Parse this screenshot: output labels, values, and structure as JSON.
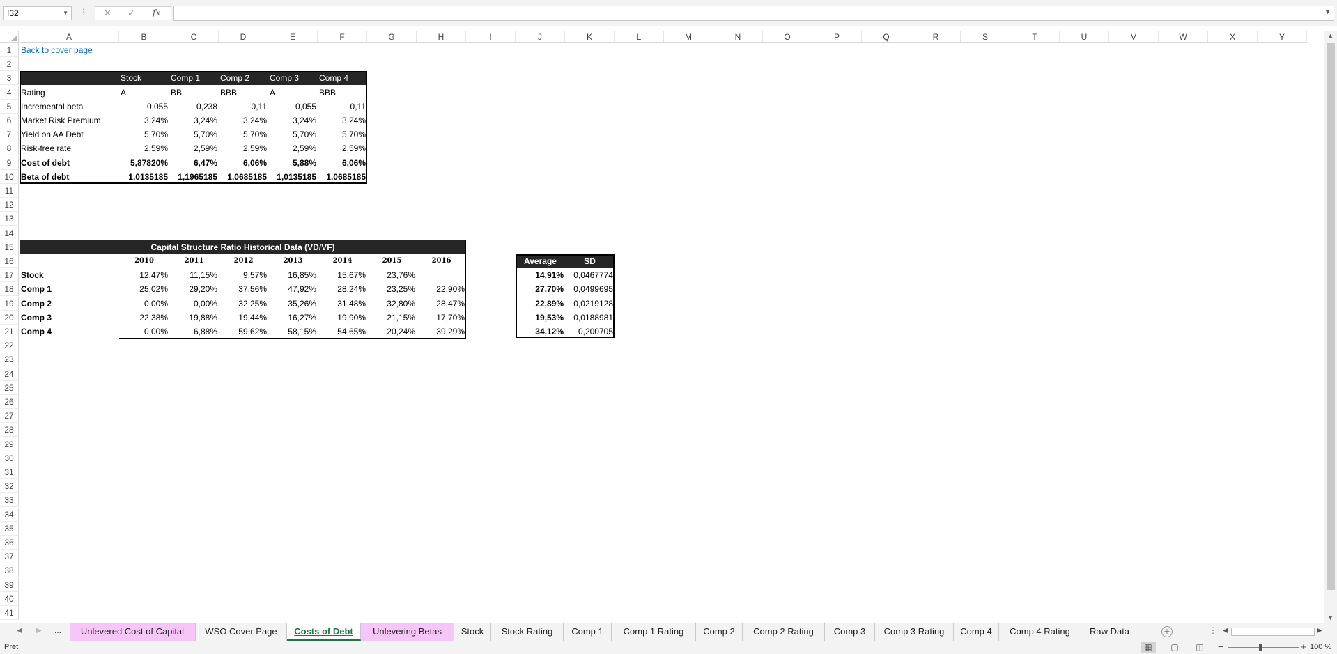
{
  "formula_bar": {
    "name_box": "I32",
    "formula": "",
    "cancel_icon": "✕",
    "enter_icon": "✓",
    "fx_label": "fx"
  },
  "columns": [
    "A",
    "B",
    "C",
    "D",
    "E",
    "F",
    "G",
    "H",
    "I",
    "J",
    "K",
    "L",
    "M",
    "N",
    "O",
    "P",
    "Q",
    "R",
    "S",
    "T",
    "U",
    "V",
    "W",
    "X",
    "Y"
  ],
  "rows": [
    "1",
    "2",
    "3",
    "4",
    "5",
    "6",
    "7",
    "8",
    "9",
    "10",
    "11",
    "12",
    "13",
    "14",
    "15",
    "16",
    "17",
    "18",
    "19",
    "20",
    "21",
    "22",
    "23",
    "24",
    "25",
    "26",
    "27",
    "28",
    "29",
    "30",
    "31",
    "32",
    "33",
    "34",
    "35",
    "36",
    "37",
    "38",
    "39",
    "40",
    "41"
  ],
  "link": {
    "text": "Back to cover page"
  },
  "debt_table": {
    "headers": [
      "Stock",
      "Comp 1",
      "Comp 2",
      "Comp 3",
      "Comp 4"
    ],
    "rows": [
      {
        "label": "Rating",
        "values": [
          "A",
          "BB",
          "BBB",
          "A",
          "BBB"
        ],
        "bold": false,
        "align": "left"
      },
      {
        "label": "Incremental beta",
        "values": [
          "0,055",
          "0,238",
          "0,11",
          "0,055",
          "0,11"
        ],
        "bold": false,
        "align": "right"
      },
      {
        "label": "Market Risk Premium",
        "values": [
          "3,24%",
          "3,24%",
          "3,24%",
          "3,24%",
          "3,24%"
        ],
        "bold": false,
        "align": "right"
      },
      {
        "label": "Yield on AA Debt",
        "values": [
          "5,70%",
          "5,70%",
          "5,70%",
          "5,70%",
          "5,70%"
        ],
        "bold": false,
        "align": "right"
      },
      {
        "label": "Risk-free rate",
        "values": [
          "2,59%",
          "2,59%",
          "2,59%",
          "2,59%",
          "2,59%"
        ],
        "bold": false,
        "align": "right"
      },
      {
        "label": "Cost of debt",
        "values": [
          "5,87820%",
          "6,47%",
          "6,06%",
          "5,88%",
          "6,06%"
        ],
        "bold": true,
        "align": "right"
      },
      {
        "label": "Beta of debt",
        "values": [
          "1,0135185",
          "1,1965185",
          "1,0685185",
          "1,0135185",
          "1,0685185"
        ],
        "bold": true,
        "align": "right"
      }
    ]
  },
  "capital_table": {
    "title": "Capital Structure Ratio Historical Data (VD/VF)",
    "years": [
      "2010",
      "2011",
      "2012",
      "2013",
      "2014",
      "2015",
      "2016"
    ],
    "rows": [
      {
        "label": "Stock",
        "values": [
          "12,47%",
          "11,15%",
          "9,57%",
          "16,85%",
          "15,67%",
          "23,76%",
          ""
        ]
      },
      {
        "label": "Comp 1",
        "values": [
          "25,02%",
          "29,20%",
          "37,56%",
          "47,92%",
          "28,24%",
          "23,25%",
          "22,90%"
        ]
      },
      {
        "label": "Comp 2",
        "values": [
          "0,00%",
          "0,00%",
          "32,25%",
          "35,26%",
          "31,48%",
          "32,80%",
          "28,47%"
        ]
      },
      {
        "label": "Comp 3",
        "values": [
          "22,38%",
          "19,88%",
          "19,44%",
          "16,27%",
          "19,90%",
          "21,15%",
          "17,70%"
        ]
      },
      {
        "label": "Comp 4",
        "values": [
          "0,00%",
          "6,88%",
          "59,62%",
          "58,15%",
          "54,65%",
          "20,24%",
          "39,29%"
        ]
      }
    ]
  },
  "stats_table": {
    "headers": [
      "Average",
      "SD"
    ],
    "rows": [
      [
        "14,91%",
        "0,0467774"
      ],
      [
        "27,70%",
        "0,0499695"
      ],
      [
        "22,89%",
        "0,0219128"
      ],
      [
        "19,53%",
        "0,0188981"
      ],
      [
        "34,12%",
        "0,200705"
      ]
    ]
  },
  "tabs": [
    {
      "label": "Unlevered Cost of Capital",
      "style": "pink"
    },
    {
      "label": "WSO Cover Page",
      "style": "plain"
    },
    {
      "label": "Costs of Debt",
      "style": "active"
    },
    {
      "label": "Unlevering Betas",
      "style": "pink"
    },
    {
      "label": "Stock",
      "style": "plain"
    },
    {
      "label": "Stock Rating",
      "style": "plain"
    },
    {
      "label": "Comp 1",
      "style": "plain"
    },
    {
      "label": "Comp 1 Rating",
      "style": "plain"
    },
    {
      "label": "Comp 2",
      "style": "plain"
    },
    {
      "label": "Comp 2 Rating",
      "style": "plain"
    },
    {
      "label": "Comp 3",
      "style": "plain"
    },
    {
      "label": "Comp 3 Rating",
      "style": "plain"
    },
    {
      "label": "Comp 4",
      "style": "plain"
    },
    {
      "label": "Comp 4 Rating",
      "style": "plain"
    },
    {
      "label": "Raw Data",
      "style": "plain"
    }
  ],
  "tab_nav": {
    "more": "..."
  },
  "status_bar": {
    "status": "Prêt",
    "zoom": "100 %"
  },
  "colors": {
    "header_dark": "#262626",
    "tab_pink": "#f5c6f7",
    "excel_green": "#217346",
    "link_blue": "#0563c1"
  }
}
